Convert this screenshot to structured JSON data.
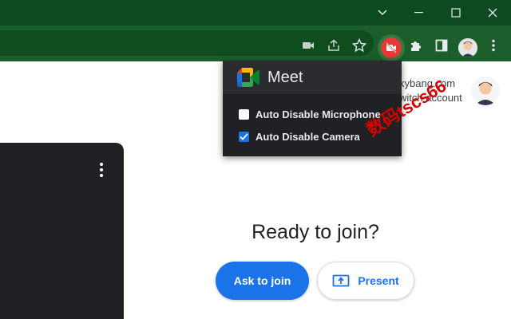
{
  "toolbar": {
    "icons": [
      "camera-icon",
      "share-icon",
      "star-icon",
      "extension-active-icon",
      "puzzle-icon",
      "sidepanel-icon",
      "profile-avatar",
      "menu-icon"
    ]
  },
  "account": {
    "email_partial": "kybang.com",
    "switch_partial": "witch account"
  },
  "popup": {
    "title": "Meet",
    "options": [
      {
        "label": "Auto Disable Microphone",
        "checked": false
      },
      {
        "label": "Auto Disable Camera",
        "checked": true
      }
    ]
  },
  "main": {
    "title": "Ready to join?",
    "ask_label": "Ask to join",
    "present_label": "Present"
  },
  "watermark": "数码tscs66",
  "colors": {
    "titlebar": "#0e4a1f",
    "toolbar": "#1b5e2b",
    "accent": "#1a73e8",
    "popup_bg": "#202124"
  }
}
